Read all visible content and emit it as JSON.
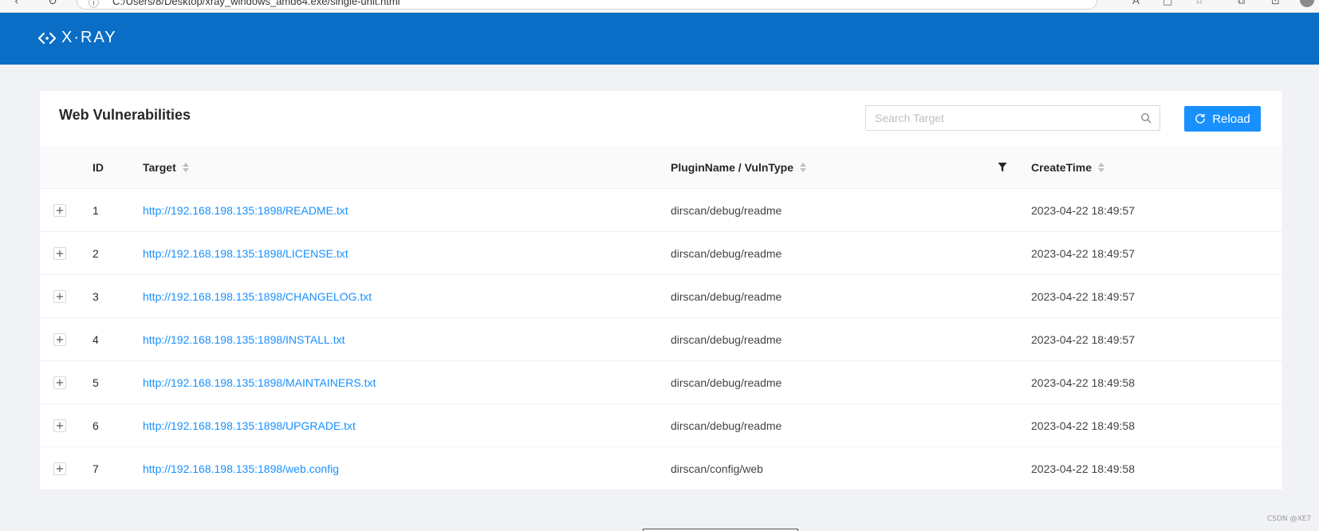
{
  "browser": {
    "address_text": "C:/Users/8/Desktop/xray_windows_amd64.exe/single-unit.html",
    "info_icon": "info-icon",
    "back_icon": "back-arrow-icon",
    "refresh_icon": "refresh-icon"
  },
  "header": {
    "logo_text": "X·RAY",
    "logo_icon": "xray-logo-icon",
    "background_color": "#0a6dc6"
  },
  "card": {
    "title": "Web Vulnerabilities",
    "search": {
      "placeholder": "Search Target",
      "value": "",
      "icon": "search-icon"
    },
    "reload": {
      "label": "Reload",
      "icon": "reload-icon",
      "color": "#1890ff"
    }
  },
  "table": {
    "columns": {
      "id": "ID",
      "target": "Target",
      "plugin": "PluginName / VulnType",
      "create_time": "CreateTime"
    },
    "filter_icon": "filter-icon",
    "expand_label": "+",
    "link_color": "#1890ff",
    "rows": [
      {
        "id": "1",
        "target": "http://192.168.198.135:1898/README.txt",
        "plugin": "dirscan/debug/readme",
        "create_time": "2023-04-22 18:49:57"
      },
      {
        "id": "2",
        "target": "http://192.168.198.135:1898/LICENSE.txt",
        "plugin": "dirscan/debug/readme",
        "create_time": "2023-04-22 18:49:57"
      },
      {
        "id": "3",
        "target": "http://192.168.198.135:1898/CHANGELOG.txt",
        "plugin": "dirscan/debug/readme",
        "create_time": "2023-04-22 18:49:57"
      },
      {
        "id": "4",
        "target": "http://192.168.198.135:1898/INSTALL.txt",
        "plugin": "dirscan/debug/readme",
        "create_time": "2023-04-22 18:49:57"
      },
      {
        "id": "5",
        "target": "http://192.168.198.135:1898/MAINTAINERS.txt",
        "plugin": "dirscan/debug/readme",
        "create_time": "2023-04-22 18:49:58"
      },
      {
        "id": "6",
        "target": "http://192.168.198.135:1898/UPGRADE.txt",
        "plugin": "dirscan/debug/readme",
        "create_time": "2023-04-22 18:49:58"
      },
      {
        "id": "7",
        "target": "http://192.168.198.135:1898/web.config",
        "plugin": "dirscan/config/web",
        "create_time": "2023-04-22 18:49:58"
      }
    ]
  },
  "watermark": "CSDN @XE7"
}
